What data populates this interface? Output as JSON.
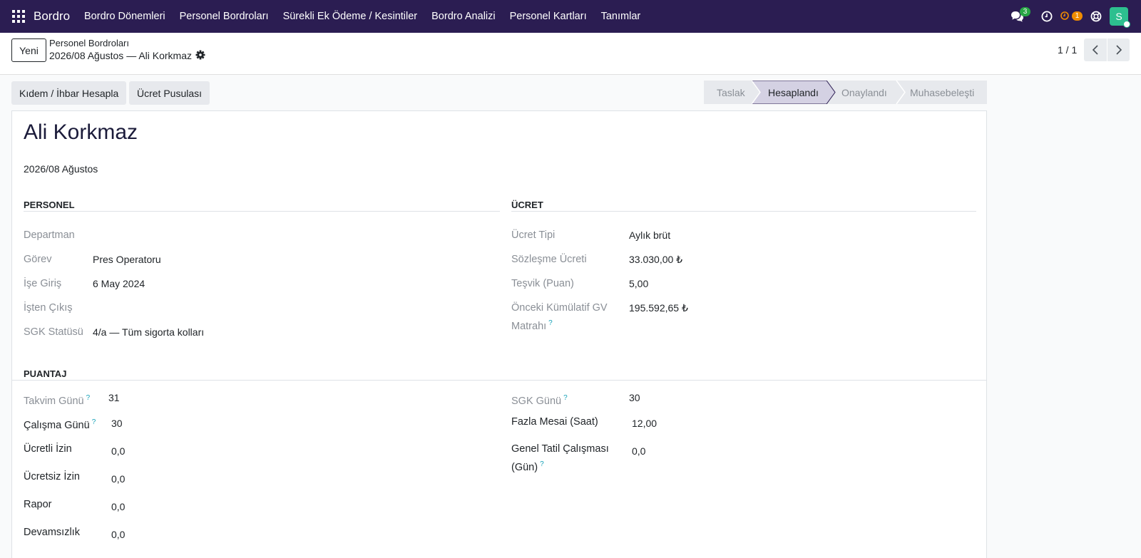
{
  "navbar": {
    "brand": "Bordro",
    "menu": [
      "Bordro Dönemleri",
      "Personel Bordroları",
      "Sürekli Ek Ödeme / Kesintiler",
      "Bordro Analizi",
      "Personel Kartları",
      "Tanımlar"
    ],
    "messages_count": "3",
    "activities_count": "1",
    "avatar_letter": "S",
    "colors": {
      "bar": "#2b1d52",
      "messages_badge": "#28a745",
      "activities_badge": "#f08c00",
      "avatar": "#2dbf8f"
    }
  },
  "control": {
    "new_label": "Yeni",
    "breadcrumb_parent": "Personel Bordroları",
    "breadcrumb_current": "2026/08 Ağustos — Ali Korkmaz",
    "pager": "1 / 1"
  },
  "actions": {
    "severance": "Kıdem / İhbar Hesapla",
    "payslip": "Ücret Pusulası"
  },
  "status": {
    "stages": [
      "Taslak",
      "Hesaplandı",
      "Onaylandı",
      "Muhasebeleşti"
    ],
    "active": "Hesaplandı"
  },
  "record": {
    "name": "Ali Korkmaz",
    "period": "2026/08 Ağustos"
  },
  "personel": {
    "title": "PERSONEL",
    "fields": [
      {
        "label": "Departman",
        "value": ""
      },
      {
        "label": "Görev",
        "value": "Pres Operatoru"
      },
      {
        "label": "İşe Giriş",
        "value": "6 May 2024"
      },
      {
        "label": "İşten Çıkış",
        "value": ""
      },
      {
        "label": "SGK Statüsü",
        "value": "4/a — Tüm sigorta kolları"
      }
    ]
  },
  "ucret": {
    "title": "ÜCRET",
    "fields": [
      {
        "label": "Ücret Tipi",
        "value": "Aylık brüt"
      },
      {
        "label": "Sözleşme Ücreti",
        "value": "33.030,00 ₺"
      },
      {
        "label": "Teşvik (Puan)",
        "value": "5,00"
      },
      {
        "label": "Önceki Kümülatif GV",
        "label2": "Matrahı",
        "value": "195.592,65 ₺"
      }
    ]
  },
  "puantaj": {
    "title": "PUANTAJ",
    "help_mark": "?",
    "left": [
      {
        "label": "Takvim Günü",
        "value": "31"
      },
      {
        "label": "Çalışma Günü",
        "value": "30"
      },
      {
        "label": "Ücretli İzin",
        "value": "0,0"
      },
      {
        "label": "Ücretsiz İzin",
        "value": "0,0"
      },
      {
        "label": "Rapor",
        "value": "0,0"
      },
      {
        "label": "Devamsızlık",
        "value": "0,0"
      }
    ],
    "right": [
      {
        "label": "SGK Günü",
        "value": "30"
      },
      {
        "label": "Fazla Mesai (Saat)",
        "value": "12,00"
      },
      {
        "label": "Genel Tatil Çalışması",
        "label2": "(Gün)",
        "value": "0,0"
      }
    ]
  }
}
